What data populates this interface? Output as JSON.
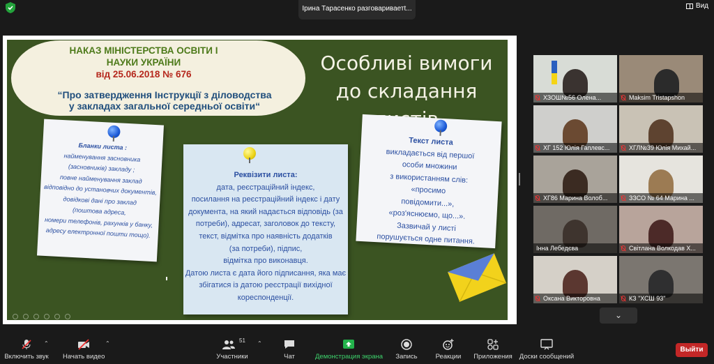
{
  "topbar": {
    "speaking_indicator": "Ірина Тарасенко разговариваетt...",
    "view_label": "Вид",
    "security_color": "#23a23b"
  },
  "slide": {
    "order_line1": "НАКАЗ МІНІСТЕРСТВА ОСВІТИ І",
    "order_line2": "НАУКИ УКРАЇНИ",
    "order_date": "від 25.06.2018 № 676",
    "order_subtitle_line1": "“Про затвердження Інструкції з діловодства",
    "order_subtitle_line2": "у закладах загальної середньої освіти“",
    "title_line1": "Особливі вимоги",
    "title_line2": "до складання листів",
    "note1": {
      "heading": "Бланки листа :",
      "lines": [
        "найменування засновника",
        "(засновників) закладу ;",
        "повне найменування заклад",
        "відповідно до установчих документів,",
        "довідкові дані про заклад",
        "(поштова адреса,",
        "номери телефонів, рахунків у банку,",
        "адресу електронної пошти тощо)."
      ]
    },
    "note2": {
      "heading": "Реквізити листа:",
      "lines": [
        "дата, реєстраційний індекс,",
        "посилання на реєстраційний індекс і дату",
        "документа, на який надається відповідь (за",
        "потреби), адресат, заголовок до тексту,",
        "текст, відмітка про наявність додатків",
        "(за потреби), підпис,",
        "відмітка про виконавця.",
        "Датою листа є дата його підписання, яка має",
        "збігатися із датою реєстрації вихідної",
        "кореспонденції."
      ]
    },
    "note3": {
      "heading": "Текст листа",
      "lines": [
        "викладається від першої",
        "особи множини",
        "з використанням слів:",
        "«просимо",
        "повідомити...»,",
        "«роз'яснюємо, що...».",
        "Зазвичай у листі",
        "порушується одне питання."
      ]
    }
  },
  "participants": [
    {
      "name": "ХЗОШ№56      Олена...",
      "bg": "#d8dcd6",
      "person": "#3a3330"
    },
    {
      "name": "Maksim Tristapshon",
      "bg": "#9a8a78",
      "person": "#2b2b2b"
    },
    {
      "name": "ХГ 152 Юлія Гаплевс...",
      "bg": "#cfcfcc",
      "person": "#6b4a32"
    },
    {
      "name": "ХГЛ№39 Юлія Михай...",
      "bg": "#c9c2b5",
      "person": "#5e4330"
    },
    {
      "name": "ХГ86 Марина Волоб...",
      "bg": "#a9a39a",
      "person": "#3b2b22"
    },
    {
      "name": "ЗЗСО № 64 Марина ...",
      "bg": "#e6e4de",
      "person": "#9c7b53"
    },
    {
      "name": "Інна Лебедєва",
      "bg": "#6f6a64",
      "person": "#3e342e"
    },
    {
      "name": "Світлана Волкодав Х...",
      "bg": "#b8a49b",
      "person": "#4c2a28"
    },
    {
      "name": "Оксана Викторовна",
      "bg": "#d5d0c8",
      "person": "#5b3730"
    },
    {
      "name": "КЗ \"ХСШ 93\"",
      "bg": "#7b7670",
      "person": "#2f2f30"
    }
  ],
  "toolbar": {
    "mute": "Включить звук",
    "video": "Начать видео",
    "participants": "Участники",
    "participants_count": "51",
    "chat": "Чат",
    "share": "Демонстрация экрана",
    "record": "Запись",
    "reactions": "Реакции",
    "apps": "Приложения",
    "whiteboard": "Доски сообщений",
    "leave": "Выйти"
  }
}
